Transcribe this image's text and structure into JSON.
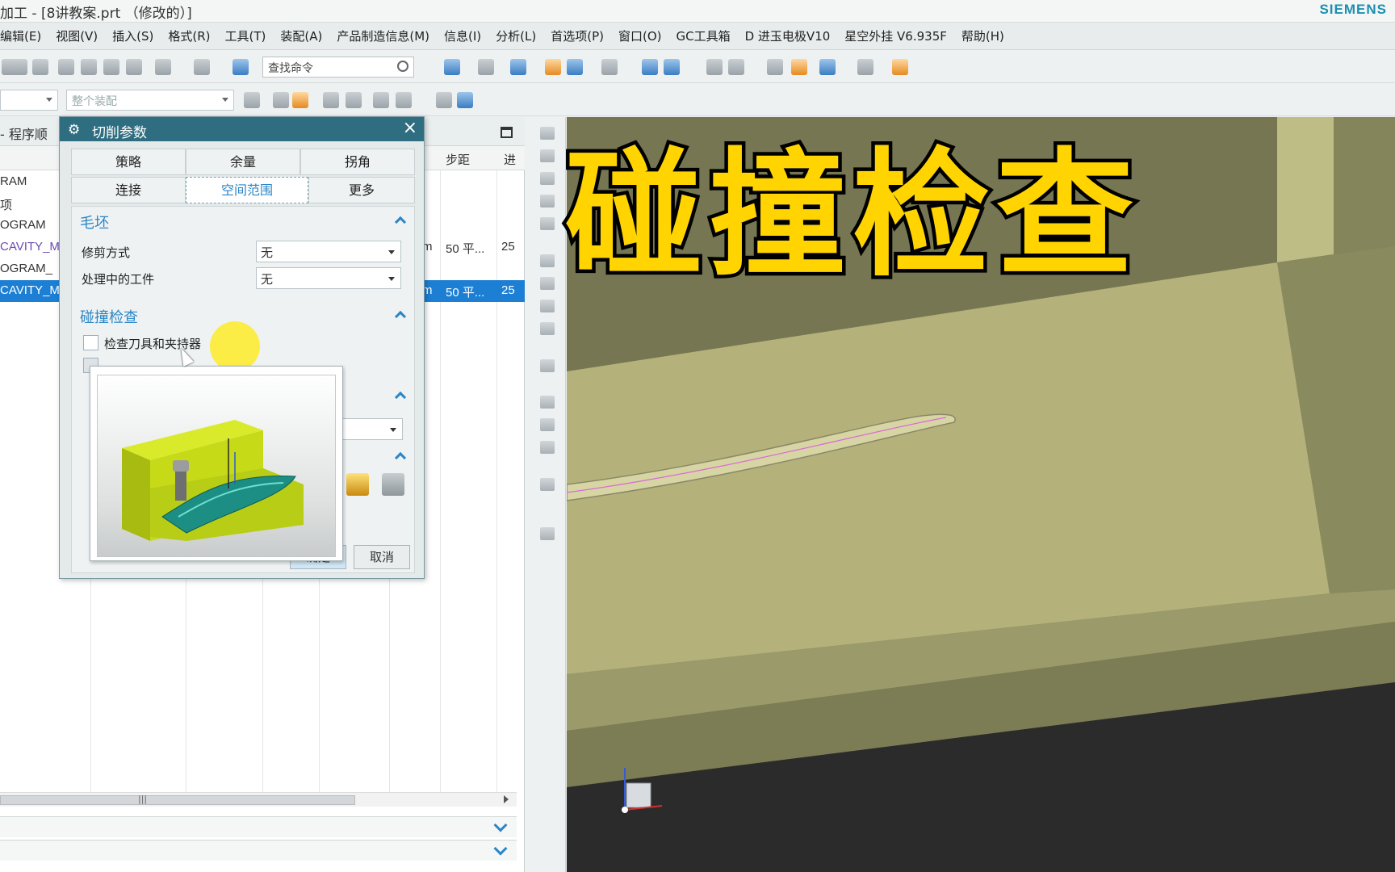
{
  "titlebar": {
    "title": "加工 - [8讲教案.prt （修改的）]",
    "brand": "SIEMENS"
  },
  "menu": [
    "编辑(E)",
    "视图(V)",
    "插入(S)",
    "格式(R)",
    "工具(T)",
    "装配(A)",
    "产品制造信息(M)",
    "信息(I)",
    "分析(L)",
    "首选项(P)",
    "窗口(O)",
    "GC工具箱",
    "D 进玉电极V10",
    "星空外挂 V6.935F",
    "帮助(H)"
  ],
  "toolbar": {
    "search_placeholder": "查找命令",
    "assembly_combo": "整个装配"
  },
  "navigator": {
    "header": "- 程序顺",
    "columns": {
      "step": "步距",
      "feed": "进"
    },
    "rows": [
      {
        "name": "RAM",
        "purple": false
      },
      {
        "name": "项",
        "purple": false
      },
      {
        "name": "OGRAM",
        "purple": false
      },
      {
        "name": "CAVITY_M",
        "purple": true,
        "col3": "m",
        "step": "50 平...",
        "feed": "25"
      },
      {
        "name": "OGRAM_",
        "purple": false
      },
      {
        "name": "CAVITY_M",
        "purple": true,
        "col3": "m",
        "step": "50 平...",
        "feed": "25",
        "selected": true
      }
    ]
  },
  "dialog": {
    "title": "切削参数",
    "tabs": [
      "策略",
      "余量",
      "拐角",
      "连接",
      "空间范围",
      "更多"
    ],
    "active_tab": "空间范围",
    "section_blank": "毛坯",
    "trim_label": "修剪方式",
    "trim_value": "无",
    "ipw_label": "处理中的工件",
    "ipw_value": "无",
    "section_collision": "碰撞检查",
    "check_label": "检查刀具和夹持器",
    "ok": "确定",
    "cancel": "取消"
  },
  "overlay": {
    "text": "碰撞检查"
  },
  "colors": {
    "accent": "#2a86c7",
    "dialog_title": "#2f6e80",
    "overlay_text": "#ffd400",
    "selected_row": "#1c7fd4"
  }
}
